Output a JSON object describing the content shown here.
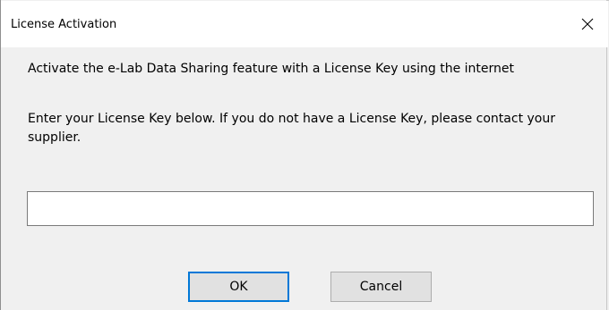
{
  "dialog": {
    "title": "License Activation",
    "close_icon": "close-icon",
    "message_line1": "Activate the e-Lab Data Sharing feature with a License Key using the internet",
    "message_line2": "Enter your License Key below. If you do not have a License Key, please contact your supplier.",
    "license_input": {
      "value": "",
      "placeholder": ""
    },
    "ok_label": "OK",
    "cancel_label": "Cancel"
  },
  "colors": {
    "background": "#f0f0f0",
    "titlebar": "#ffffff",
    "default_button_border": "#0078d7",
    "button_face": "#e1e1e1"
  }
}
